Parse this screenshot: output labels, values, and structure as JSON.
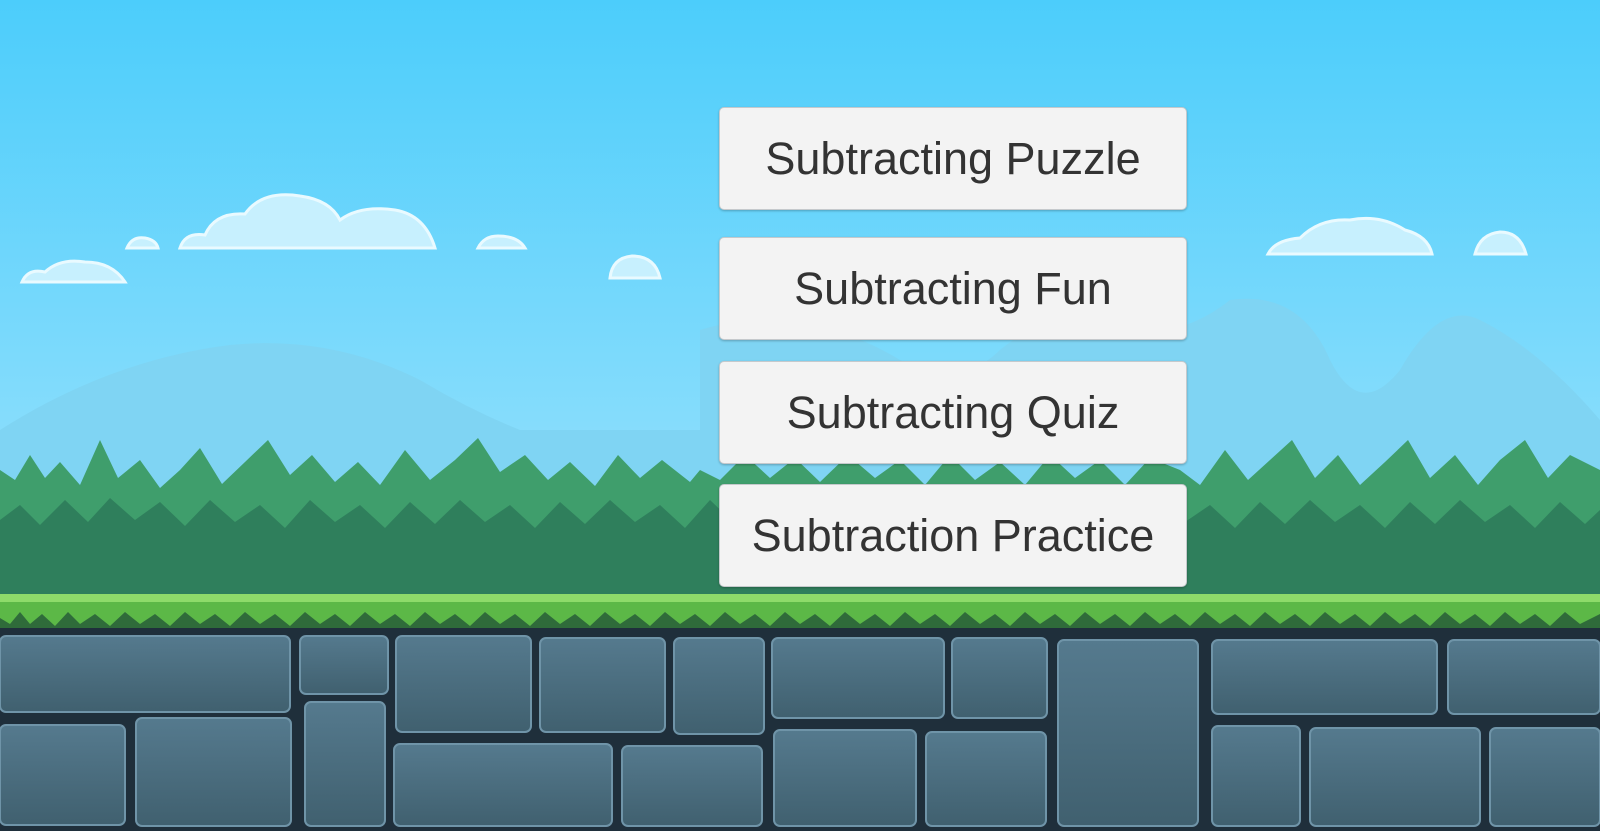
{
  "scene": {
    "background": "side-scrolling platformer landscape",
    "colors": {
      "sky_top": "#4ccdfb",
      "sky_bottom": "#b4ebfd",
      "mountain": "#7fd4f3",
      "bush_dark": "#2f7f5c",
      "bush_light": "#3f9e6c",
      "grass": "#6fc94e",
      "stone": "#4a6a7e",
      "mortar": "#1f2f3b"
    }
  },
  "menu": {
    "buttons": [
      {
        "label": "Subtracting Puzzle"
      },
      {
        "label": "Subtracting Fun"
      },
      {
        "label": "Subtracting Quiz"
      },
      {
        "label": "Subtraction Practice"
      }
    ]
  }
}
